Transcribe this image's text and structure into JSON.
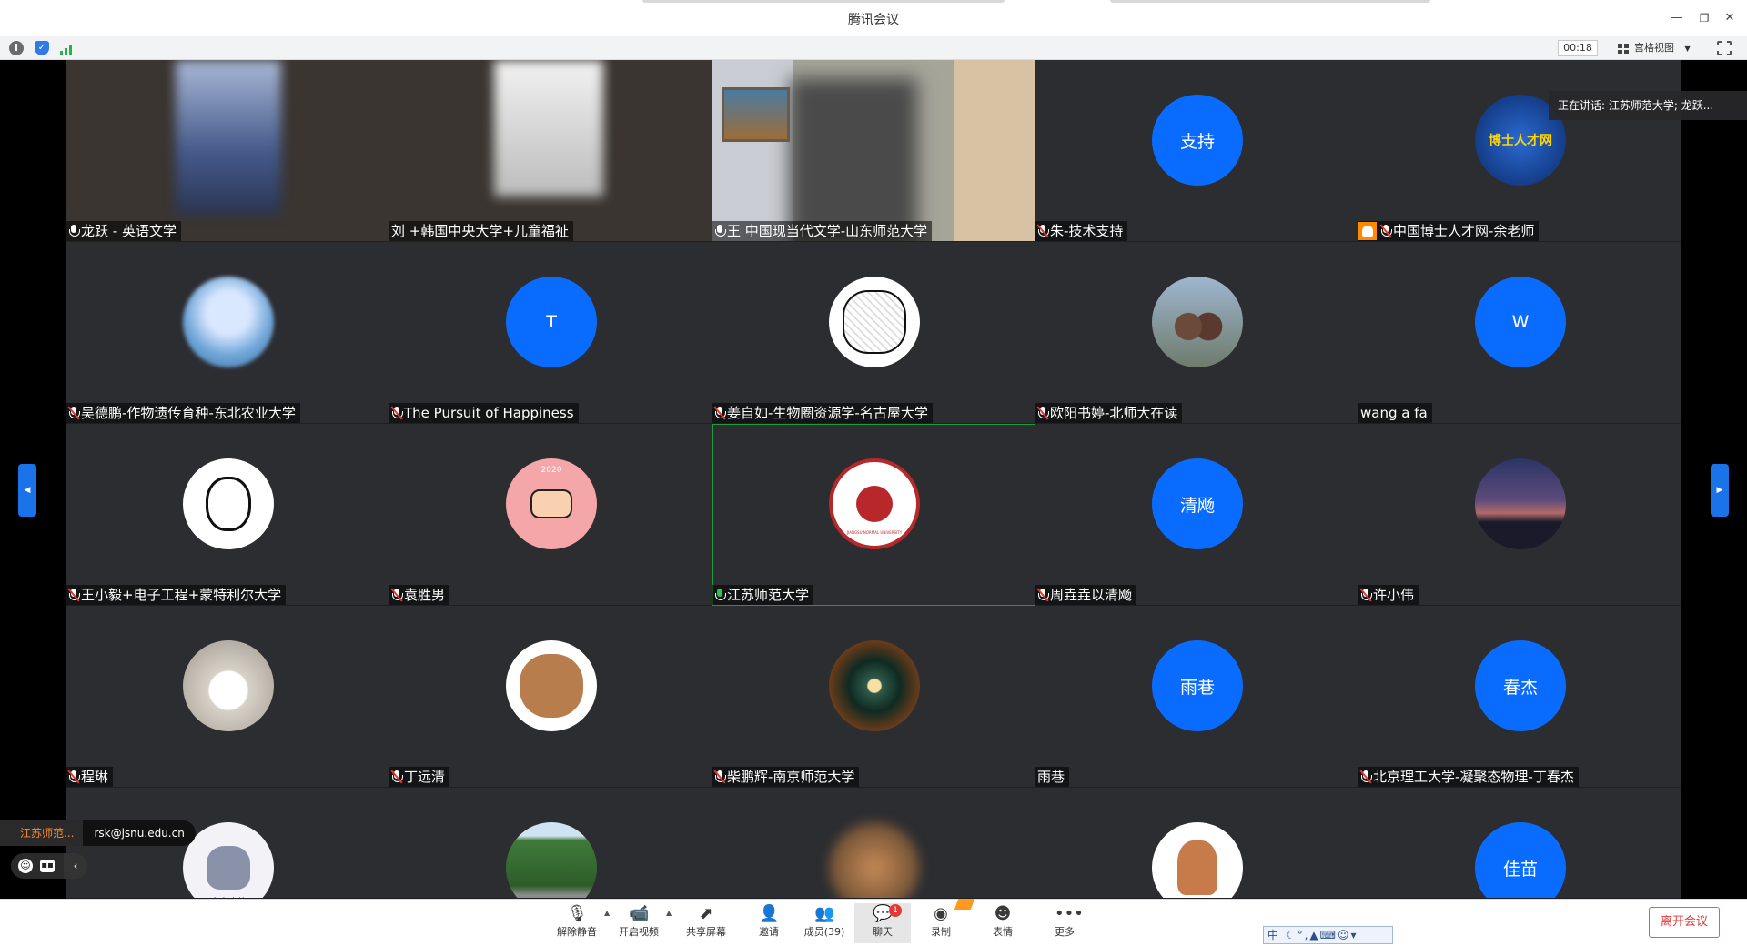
{
  "app": {
    "title": "腾讯会议"
  },
  "status": {
    "timer": "00:18",
    "view_mode": "宫格视图"
  },
  "toast": {
    "speaking": "正在讲话: 江苏师范大学; 龙跃..."
  },
  "participants": [
    {
      "name": "龙跃 - 英语文学",
      "mic": "on",
      "kind": "video"
    },
    {
      "name": "刘    +韩国中央大学+儿童福祉",
      "mic": "none",
      "kind": "video"
    },
    {
      "name": "王      中国现当代文学-山东师范大学",
      "mic": "on",
      "kind": "video"
    },
    {
      "name": "朱-技术支持",
      "mic": "muted",
      "avatar_text": "支持",
      "kind": "text"
    },
    {
      "name": "中国博士人才网-余老师",
      "mic": "muted",
      "host": true,
      "avatar_label": "博士人才网",
      "kind": "logo"
    },
    {
      "name": "吴德鹏-作物遗传育种-东北农业大学",
      "mic": "muted",
      "kind": "photo"
    },
    {
      "name": "The Pursuit of Happiness",
      "mic": "muted",
      "avatar_text": "T",
      "kind": "text"
    },
    {
      "name": "姜自如-生物圈资源学-名古屋大学",
      "mic": "muted",
      "kind": "photo"
    },
    {
      "name": "欧阳书婷-北师大在读",
      "mic": "muted",
      "kind": "photo"
    },
    {
      "name": "wang a fa",
      "mic": "none",
      "avatar_text": "W",
      "kind": "text"
    },
    {
      "name": "王小毅+电子工程+蒙特利尔大学",
      "mic": "muted",
      "kind": "photo"
    },
    {
      "name": "袁胜男",
      "mic": "muted",
      "avatar_label": "2020",
      "kind": "photo"
    },
    {
      "name": "江苏师范大学",
      "mic": "speaking",
      "active": true,
      "avatar_label": "JIANGSU NORMAL UNIVERSITY",
      "kind": "logo"
    },
    {
      "name": "周垚垚以清飏",
      "mic": "muted",
      "avatar_text": "清飏",
      "kind": "text"
    },
    {
      "name": "许小伟",
      "mic": "muted",
      "kind": "photo"
    },
    {
      "name": "程琳",
      "mic": "muted",
      "kind": "photo"
    },
    {
      "name": "丁远清",
      "mic": "muted",
      "kind": "photo"
    },
    {
      "name": "柴鹏辉-南京师范大学",
      "mic": "muted",
      "kind": "photo"
    },
    {
      "name": "雨巷",
      "mic": "none",
      "avatar_text": "雨巷",
      "kind": "text"
    },
    {
      "name": "北京理工大学-凝聚态物理-丁春杰",
      "mic": "muted",
      "avatar_text": "春杰",
      "kind": "text"
    },
    {
      "name": "",
      "mic": "none",
      "avatar_label": "会变瘦的",
      "kind": "photo"
    },
    {
      "name": "",
      "mic": "none",
      "kind": "photo"
    },
    {
      "name": "",
      "mic": "none",
      "kind": "photo"
    },
    {
      "name": "",
      "mic": "none",
      "kind": "photo"
    },
    {
      "name": "",
      "mic": "none",
      "avatar_text": "佳苗",
      "kind": "text"
    }
  ],
  "chat_preview": {
    "sender": "江苏师范...",
    "message": "rsk@jsnu.edu.cn"
  },
  "toolbar": {
    "unmute": "解除静音",
    "start_video": "开启视频",
    "share_screen": "共享屏幕",
    "invite": "邀请",
    "members": "成员(39)",
    "chat": "聊天",
    "chat_badge": "1",
    "record": "录制",
    "reactions": "表情",
    "more": "更多",
    "leave": "离开会议",
    "ime": "中"
  },
  "colors": {
    "avatar_blue": "#0a6cff",
    "accent_green": "#1f9b3f",
    "leave_red": "#e53935"
  }
}
